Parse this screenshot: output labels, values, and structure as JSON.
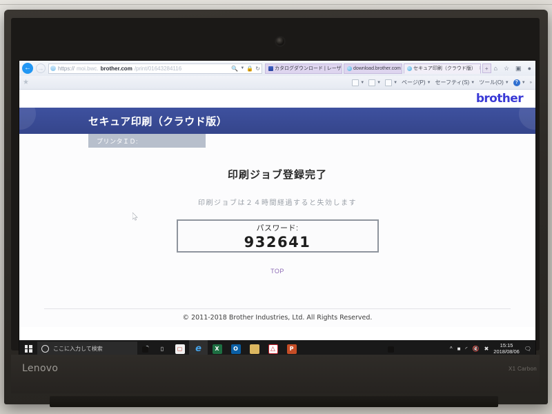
{
  "browser": {
    "back_label": "←",
    "forward_label": "→",
    "url": {
      "protocol": "https://",
      "subdomain": "moi.bwc.",
      "domain": "brother.com",
      "path": "/print/01643284116"
    },
    "address_icons": [
      "search-icon",
      "dropdown-caret",
      "lock-icon",
      "refresh-icon"
    ],
    "tabs": [
      {
        "label": "カタログダウンロード | レーザープ...",
        "active": false
      },
      {
        "label": "download.brother.com",
        "active": false
      },
      {
        "label": "セキュア印刷（クラウド版）",
        "active": true
      }
    ],
    "new_tab_label": "⬜",
    "window_controls": [
      "—",
      "❐",
      "✕"
    ],
    "command_bar": [
      {
        "label": "ページ(P)"
      },
      {
        "label": "セーフティ(S)"
      },
      {
        "label": "ツール(O)"
      }
    ],
    "help_label": "?",
    "overflow_label": "»"
  },
  "page": {
    "logo": "brother",
    "banner_title": "セキュア印刷（クラウド版）",
    "printer_id_label": "プリンタＩＤ:",
    "job_title": "印刷ジョブ登録完了",
    "job_note": "印刷ジョブは２４時間経過すると失効します",
    "password_label": "パスワード:",
    "password_value": "932641",
    "top_link": "TOP",
    "copyright": "© 2011-2018 Brother Industries, Ltd. All Rights Reserved.",
    "colors": {
      "banner": "#3e519f",
      "logo": "#3a3ad6",
      "printer_id_bar": "#b7bfcc",
      "link": "#8d6bb5"
    }
  },
  "taskbar": {
    "start_label": "start-button",
    "search_placeholder": "ここに入力して検索",
    "tray_icons": [
      "cortana-icon",
      "task-view-icon"
    ],
    "apps": [
      {
        "name": "microsoft-store",
        "glyph": "Ὥ2",
        "color": "#f3f3f3",
        "text": "⚲",
        "active": false
      },
      {
        "name": "internet-explorer",
        "glyph": "e",
        "color": "#1a7ec8",
        "text": "e",
        "active": true
      },
      {
        "name": "excel",
        "glyph": "X",
        "color": "#1d6f42",
        "text": "X",
        "active": false
      },
      {
        "name": "outlook",
        "glyph": "O",
        "color": "#0a5fa5",
        "text": "O",
        "active": false
      },
      {
        "name": "file-explorer",
        "glyph": "❑",
        "color": "#e3b84a",
        "text": "",
        "active": false
      },
      {
        "name": "adobe-reader",
        "glyph": "A",
        "color": "#c8202a",
        "text": "⤓",
        "active": false
      },
      {
        "name": "powerpoint",
        "glyph": "P",
        "color": "#c64d26",
        "text": "P",
        "active": false
      }
    ],
    "status_icons": [
      "chevron-up-icon",
      "battery-icon",
      "wifi-icon",
      "volume-muted-icon",
      "onedrive-offline-icon"
    ],
    "clock_time": "15:15",
    "clock_date": "2018/08/06",
    "action_center": "action-center-icon"
  },
  "hardware": {
    "brand": "Lenovo",
    "model": "X1 Carbon"
  }
}
